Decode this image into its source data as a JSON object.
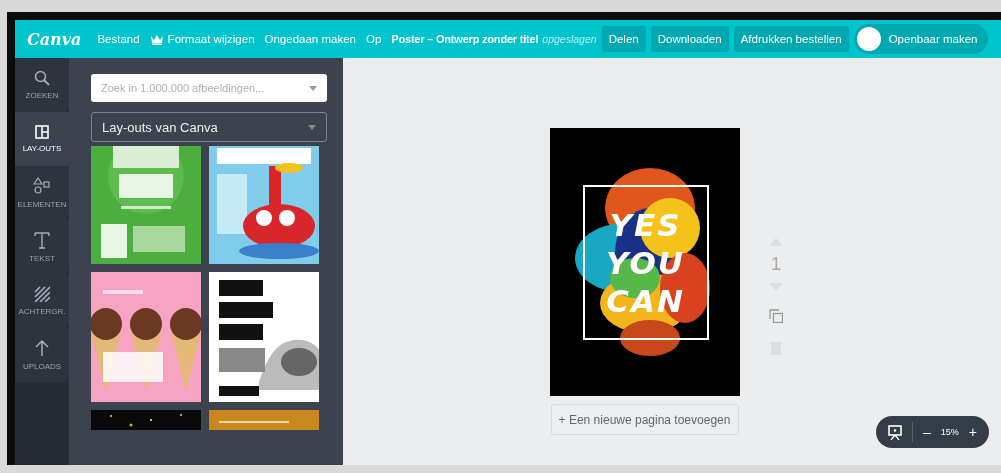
{
  "topbar": {
    "logo": "Canva",
    "menu": [
      "Bestand",
      "Formaat wijzigen",
      "Ongedaan maken",
      "Op"
    ],
    "title": "Poster – Ontwerp zonder titel",
    "save_status": "opgeslagen",
    "buttons": [
      "Delen",
      "Downloaden",
      "Afdrukken bestellen"
    ],
    "public_toggle": {
      "label": "Openbaar maken",
      "on": false
    }
  },
  "sidebar": {
    "items": [
      {
        "label": "ZOEKEN",
        "selected": false
      },
      {
        "label": "LAY-OUTS",
        "selected": true
      },
      {
        "label": "ELEMENTEN",
        "selected": false
      },
      {
        "label": "TEKST",
        "selected": false
      },
      {
        "label": "ACHTERGR.",
        "selected": false
      },
      {
        "label": "UPLOADS",
        "selected": false
      }
    ]
  },
  "panel": {
    "search": {
      "placeholder": "Zoek in 1.000.000 afbeeldingen..."
    },
    "dropdown": {
      "value": "Lay-outs van Canva"
    }
  },
  "canvas": {
    "design_lines": [
      "YES",
      "YOU",
      "CAN"
    ],
    "page_number": "1",
    "add_page_button": "+ Een nieuwe pagina toevoegen"
  },
  "zoom": {
    "value": "15%",
    "minus": "–",
    "plus": "+"
  }
}
